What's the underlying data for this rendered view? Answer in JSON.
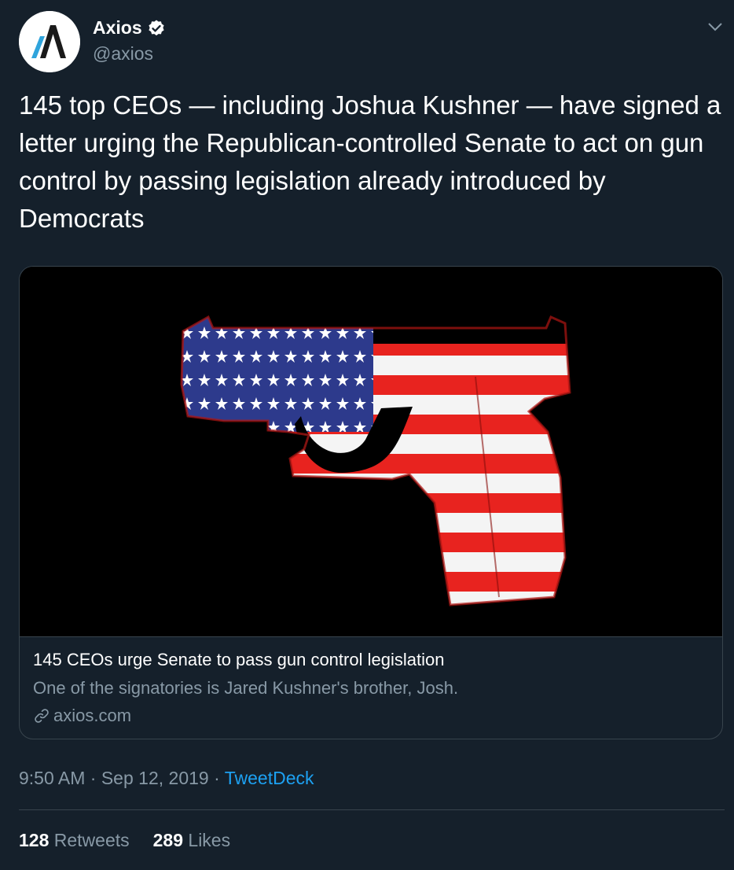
{
  "author": {
    "name": "Axios",
    "handle": "@axios",
    "verified": true,
    "avatar_icon": "axios-logo-icon"
  },
  "tweet": {
    "text": "145 top CEOs — including Joshua Kushner — have signed a letter urging the Republican-controlled Senate to act on gun control by passing legislation already introduced by Democrats"
  },
  "card": {
    "image_icon": "american-flag-pistol-image",
    "title": "145 CEOs urge Senate to pass gun control legislation",
    "description": "One of the signatories is Jared Kushner's brother, Josh.",
    "domain": "axios.com",
    "link_icon": "link-icon"
  },
  "meta": {
    "time": "9:50 AM",
    "separator": "·",
    "date": "Sep 12, 2019",
    "source": "TweetDeck"
  },
  "stats": {
    "retweets_count": "128",
    "retweets_label": "Retweets",
    "likes_count": "289",
    "likes_label": "Likes"
  },
  "colors": {
    "background": "#15202b",
    "secondary_text": "#8899a6",
    "accent": "#1da1f2",
    "border": "#38444d"
  }
}
